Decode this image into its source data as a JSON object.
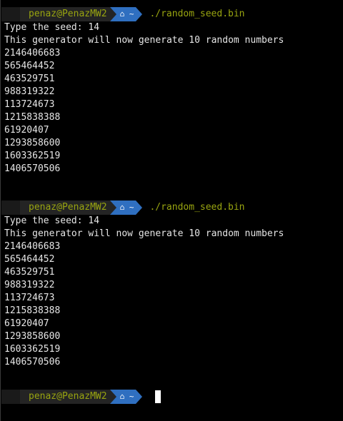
{
  "terminal": {
    "colors": {
      "background": "#000000",
      "text": "#e6e6e6",
      "prompt_user": "#98a410",
      "prompt_path_bg": "#2f6fc0",
      "command": "#98a410"
    },
    "runs": [
      {
        "prompt": {
          "user_host": "penaz@PenazMW2",
          "path_glyphs": "⌂ ~",
          "command": "./random_seed.bin"
        },
        "output": [
          "Type the seed: 14",
          "This generator will now generate 10 random numbers",
          "2146406683",
          "565464452",
          "463529751",
          "988319322",
          "113724673",
          "1215838388",
          "61920407",
          "1293858600",
          "1603362519",
          "1406570506"
        ]
      },
      {
        "prompt": {
          "user_host": "penaz@PenazMW2",
          "path_glyphs": "⌂ ~",
          "command": "./random_seed.bin"
        },
        "output": [
          "Type the seed: 14",
          "This generator will now generate 10 random numbers",
          "2146406683",
          "565464452",
          "463529751",
          "988319322",
          "113724673",
          "1215838388",
          "61920407",
          "1293858600",
          "1603362519",
          "1406570506"
        ]
      }
    ],
    "final_prompt": {
      "user_host": "penaz@PenazMW2",
      "path_glyphs": "⌂ ~",
      "command": ""
    }
  }
}
